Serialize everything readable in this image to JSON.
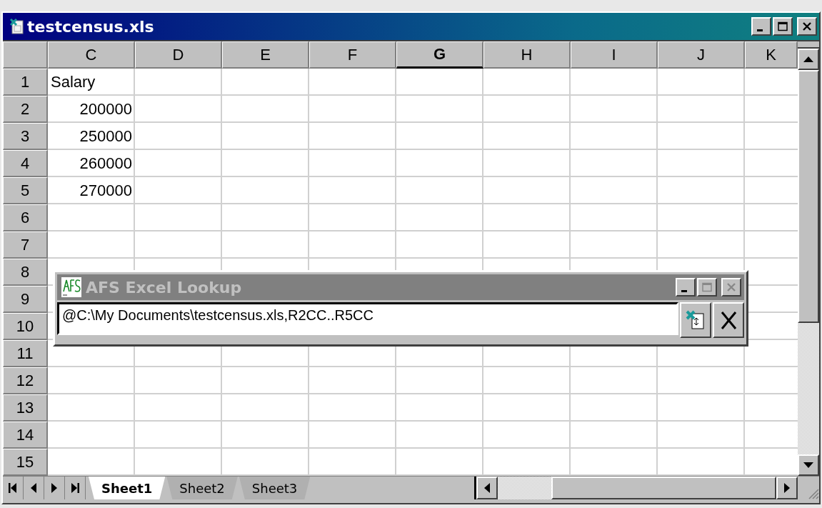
{
  "window": {
    "title": "testcensus.xls"
  },
  "columns": [
    {
      "label": "C",
      "selected": false
    },
    {
      "label": "D",
      "selected": false
    },
    {
      "label": "E",
      "selected": false
    },
    {
      "label": "F",
      "selected": false
    },
    {
      "label": "G",
      "selected": true
    },
    {
      "label": "H",
      "selected": false
    },
    {
      "label": "I",
      "selected": false
    },
    {
      "label": "J",
      "selected": false
    },
    {
      "label": "K",
      "selected": false
    }
  ],
  "rows": [
    {
      "label": "1",
      "cells": [
        {
          "value": "Salary",
          "kind": "text"
        }
      ]
    },
    {
      "label": "2",
      "cells": [
        {
          "value": "200000",
          "kind": "number"
        }
      ]
    },
    {
      "label": "3",
      "cells": [
        {
          "value": "250000",
          "kind": "number"
        }
      ]
    },
    {
      "label": "4",
      "cells": [
        {
          "value": "260000",
          "kind": "number"
        }
      ]
    },
    {
      "label": "5",
      "cells": [
        {
          "value": "270000",
          "kind": "number"
        }
      ]
    },
    {
      "label": "6",
      "cells": []
    },
    {
      "label": "7",
      "cells": []
    },
    {
      "label": "8",
      "cells": []
    },
    {
      "label": "9",
      "cells": []
    },
    {
      "label": "10",
      "cells": []
    },
    {
      "label": "11",
      "cells": []
    },
    {
      "label": "12",
      "cells": []
    },
    {
      "label": "13",
      "cells": []
    },
    {
      "label": "14",
      "cells": []
    },
    {
      "label": "15",
      "cells": []
    }
  ],
  "sheet_tabs": [
    {
      "label": "Sheet1",
      "selected": true
    },
    {
      "label": "Sheet2",
      "selected": false
    },
    {
      "label": "Sheet3",
      "selected": false
    }
  ],
  "lookup_dialog": {
    "title": "AFS Excel Lookup",
    "value": "@C:\\My Documents\\testcensus.xls,R2CC..R5CC"
  }
}
